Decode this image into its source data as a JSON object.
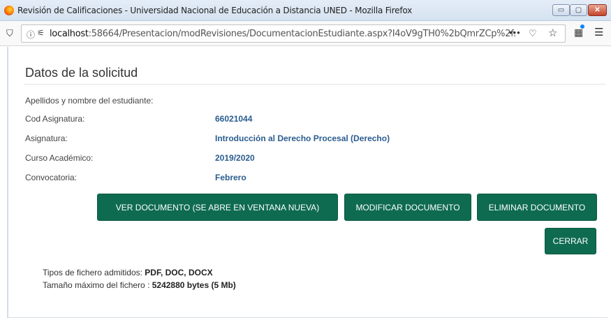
{
  "window": {
    "title": "Revisión de Calificaciones - Universidad Nacional de Educación a Distancia UNED - Mozilla Firefox",
    "minimize_glyph": "▭",
    "maximize_glyph": "▢",
    "close_glyph": "✕"
  },
  "browser": {
    "url_host": "localhost",
    "url_rest": ":58664/Presentacion/modRevisiones/DocumentacionEstudiante.aspx?I4oV9gTH0%2bQmrZCp%2f:",
    "more_glyph": "•••",
    "icons": [
      "shield-icon",
      "info-icon",
      "permissions-icon",
      "pocket-icon",
      "bookmark-star-icon",
      "extensions-icon",
      "hamburger-menu-icon"
    ]
  },
  "page": {
    "title": "Datos de la solicitud",
    "fields": [
      {
        "label": "Apellidos y nombre del estudiante:",
        "value": ""
      },
      {
        "label": "Cod Asignatura:",
        "value": "66021044"
      },
      {
        "label": "Asignatura:",
        "value": "Introducción al Derecho Procesal (Derecho)"
      },
      {
        "label": "Curso Académico:",
        "value": "2019/2020"
      },
      {
        "label": "Convocatoria:",
        "value": "Febrero"
      }
    ],
    "buttons": {
      "view": "VER DOCUMENTO (SE ABRE EN VENTANA NUEVA)",
      "modify": "MODIFICAR DOCUMENTO",
      "delete": "ELIMINAR DOCUMENTO",
      "close": "CERRAR"
    },
    "file_types_label": "Tipos de fichero admitidos: ",
    "file_types_value": "PDF, DOC, DOCX",
    "max_size_label": "Tamaño máximo del fichero : ",
    "max_size_value": "5242880 bytes (5 Mb)"
  },
  "colors": {
    "button_bg": "#0e6b4f",
    "value_text": "#2a5d8f"
  }
}
